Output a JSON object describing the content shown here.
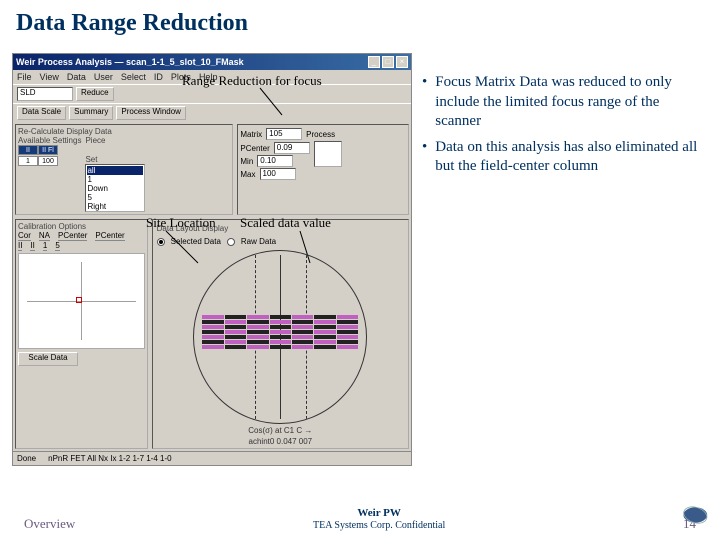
{
  "slide": {
    "title": "Data Range Reduction",
    "bullets": [
      "Focus Matrix Data was reduced to only include the limited focus range of the scanner",
      "Data on this analysis has also eliminated all but the field-center column"
    ],
    "footer_left": "Overview",
    "footer_center1": "Weir PW",
    "footer_center2": "TEA Systems Corp. Confidential",
    "footer_page": "14"
  },
  "annot": {
    "top": "Range Reduction for focus",
    "left": "Site Location",
    "right": "Scaled data value"
  },
  "app": {
    "title": "Weir Process Analysis — scan_1-1_5_slot_10_FMask",
    "menu": [
      "File",
      "View",
      "Data",
      "User",
      "Select",
      "ID",
      "Plots",
      "Help"
    ],
    "toolbar": {
      "combo": "SLD",
      "btn1": "Reduce"
    },
    "tabs": [
      "Data Scale",
      "Summary",
      "Process Window"
    ],
    "recalc": {
      "label": "Re-Calculate Display Data",
      "avail_label": "Available Settings",
      "grid": {
        "h1": "II",
        "h2": "II Fl",
        "v1": "1",
        "v2": "100"
      },
      "piece_label": "Piece",
      "set_label": "Set",
      "set_items": [
        "all",
        "1",
        "Down",
        "5",
        "Right"
      ],
      "matrix_label": "Matrix",
      "matrix_val": "105",
      "process_label": "Process",
      "pcenter_label": "PCenter",
      "pcenter_val": "0.09",
      "min_label": "Min",
      "min_val": "0.10",
      "max_label": "Max",
      "max_val": "100"
    },
    "calib": {
      "label": "Calibration Options",
      "headers": [
        "Cor",
        "NA",
        "PCenter",
        "PCenter"
      ],
      "vals": [
        "II",
        "II",
        "1",
        "5"
      ],
      "scale_btn": "Scale Data"
    },
    "wafer_panel": {
      "label": "Data Layout Display",
      "radio1": "Selected Data",
      "radio2": "Raw Data",
      "caption1": "Cos(σ) at C1 C →",
      "caption2": "achint0   0.047 007"
    },
    "status": {
      "left": "Done",
      "right": "nPnR FET   All  Nx  Ix  1-2  1-7  1-4  1-0"
    }
  }
}
